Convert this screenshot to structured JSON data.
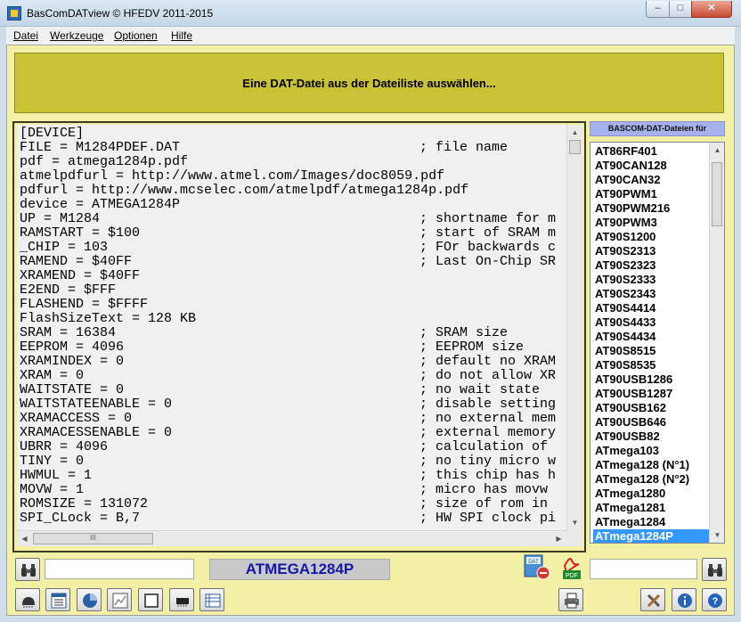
{
  "window": {
    "title": "BasComDATview © HFEDV 2011-2015",
    "controls": {
      "minimize": "–",
      "maximize": "□",
      "close": "✕"
    }
  },
  "menu": [
    "Datei",
    "Werkzeuge",
    "Optionen",
    "Hilfe"
  ],
  "banner": "Eine DAT-Datei aus der Dateiliste auswählen...",
  "dat_lines": [
    {
      "text": "[DEVICE]",
      "comment": ""
    },
    {
      "text": "FILE = M1284PDEF.DAT",
      "comment": "; file name"
    },
    {
      "text": "pdf = atmega1284p.pdf",
      "comment": ""
    },
    {
      "text": "atmelpdfurl = http://www.atmel.com/Images/doc8059.pdf",
      "comment": ""
    },
    {
      "text": "pdfurl = http://www.mcselec.com/atmelpdf/atmega1284p.pdf",
      "comment": ""
    },
    {
      "text": "device = ATMEGA1284P",
      "comment": ""
    },
    {
      "text": "UP = M1284",
      "comment": "; shortname for m"
    },
    {
      "text": "RAMSTART = $100",
      "comment": "; start of SRAM m"
    },
    {
      "text": "_CHIP = 103",
      "comment": "; FOr backwards c"
    },
    {
      "text": "RAMEND = $40FF",
      "comment": "; Last On-Chip SR"
    },
    {
      "text": "XRAMEND = $40FF",
      "comment": ""
    },
    {
      "text": "E2END = $FFF",
      "comment": ""
    },
    {
      "text": "FLASHEND = $FFFF",
      "comment": ""
    },
    {
      "text": "FlashSizeText = 128 KB",
      "comment": ""
    },
    {
      "text": "SRAM = 16384",
      "comment": "; SRAM size"
    },
    {
      "text": "EEPROM = 4096",
      "comment": "; EEPROM size"
    },
    {
      "text": "XRAMINDEX = 0",
      "comment": "; default no XRAM"
    },
    {
      "text": "XRAM = 0",
      "comment": "; do not allow XR"
    },
    {
      "text": "WAITSTATE = 0",
      "comment": "; no wait state"
    },
    {
      "text": "WAITSTATEENABLE = 0",
      "comment": "; disable setting"
    },
    {
      "text": "XRAMACCESS = 0",
      "comment": "; no external mem"
    },
    {
      "text": "XRAMACESSENABLE = 0",
      "comment": "; external memory"
    },
    {
      "text": "UBRR = 4096",
      "comment": "; calculation of"
    },
    {
      "text": "TINY = 0",
      "comment": "; no tiny micro w"
    },
    {
      "text": "HWMUL = 1",
      "comment": "; this chip has h"
    },
    {
      "text": "MOVW = 1",
      "comment": "; micro has movw"
    },
    {
      "text": "ROMSIZE = 131072",
      "comment": "; size of rom in"
    },
    {
      "text": "SPI_CLock = B,7",
      "comment": "; HW SPI clock pi"
    }
  ],
  "file_list": {
    "header": "BASCOM-DAT-Dateien für",
    "items": [
      "AT86RF401",
      "AT90CAN128",
      "AT90CAN32",
      "AT90PWM1",
      "AT90PWM216",
      "AT90PWM3",
      "AT90S1200",
      "AT90S2313",
      "AT90S2323",
      "AT90S2333",
      "AT90S2343",
      "AT90S4414",
      "AT90S4433",
      "AT90S4434",
      "AT90S8515",
      "AT90S8535",
      "AT90USB1286",
      "AT90USB1287",
      "AT90USB162",
      "AT90USB646",
      "AT90USB82",
      "ATmega103",
      "ATmega128 (N°1)",
      "ATmega128 (N°2)",
      "ATmega1280",
      "ATmega1281",
      "ATmega1284",
      "ATmega1284P"
    ],
    "selected": "ATmega1284P"
  },
  "scrollbar": {
    "grip": "III"
  },
  "bottom": {
    "left_search_value": "",
    "right_search_value": "",
    "device_name": "ATMEGA1284P",
    "dat_icon_text": "DAT",
    "pdf_icon_text": "PDF"
  },
  "colors": {
    "client_background": "#f1f0a4",
    "banner_background": "#c8c234",
    "list_header_background": "#a6b2ee",
    "selection": "#3399ff",
    "device_text": "#1616a8"
  },
  "icons": {
    "toolbar_left": [
      "binoculars-icon",
      "chip-icon",
      "list-window-icon",
      "pie-chart-icon",
      "chart-window-icon",
      "blank-window-icon",
      "ic-package-icon",
      "table-list-icon"
    ],
    "toolbar_right": [
      "printer-icon",
      "tools-icon",
      "info-icon",
      "help-icon"
    ]
  }
}
